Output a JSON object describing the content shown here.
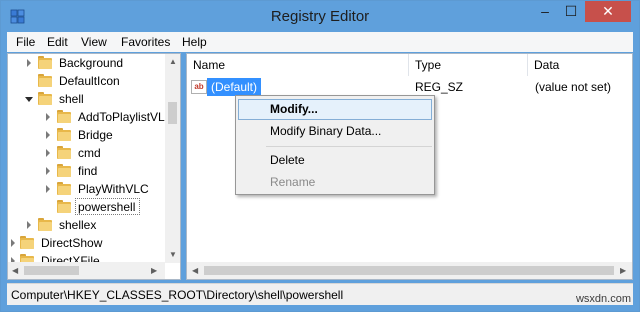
{
  "window": {
    "title": "Registry Editor",
    "minimize": "–",
    "maximize": "☐",
    "close": "✕"
  },
  "menu": {
    "items": [
      "File",
      "Edit",
      "View",
      "Favorites",
      "Help"
    ]
  },
  "tree": {
    "items": [
      {
        "label": "Background"
      },
      {
        "label": "DefaultIcon"
      },
      {
        "label": "shell"
      },
      {
        "label": "AddToPlaylistVL"
      },
      {
        "label": "Bridge"
      },
      {
        "label": "cmd"
      },
      {
        "label": "find"
      },
      {
        "label": "PlayWithVLC"
      },
      {
        "label": "powershell"
      },
      {
        "label": "shellex"
      },
      {
        "label": "DirectShow"
      },
      {
        "label": "DirectXFile"
      }
    ]
  },
  "list": {
    "columns": [
      "Name",
      "Type",
      "Data"
    ],
    "rows": [
      {
        "name": "(Default)",
        "type": "REG_SZ",
        "data": "(value not set)",
        "icon": "ab"
      }
    ]
  },
  "context_menu": {
    "items": [
      "Modify...",
      "Modify Binary Data...",
      "Delete",
      "Rename"
    ]
  },
  "status": {
    "path": "Computer\\HKEY_CLASSES_ROOT\\Directory\\shell\\powershell"
  },
  "watermark": "wsxdn.com",
  "colors": {
    "titlebar": "#5fa0dc",
    "selection": "#3390ff",
    "close": "#c7504b",
    "folder": "#e8b84a"
  }
}
